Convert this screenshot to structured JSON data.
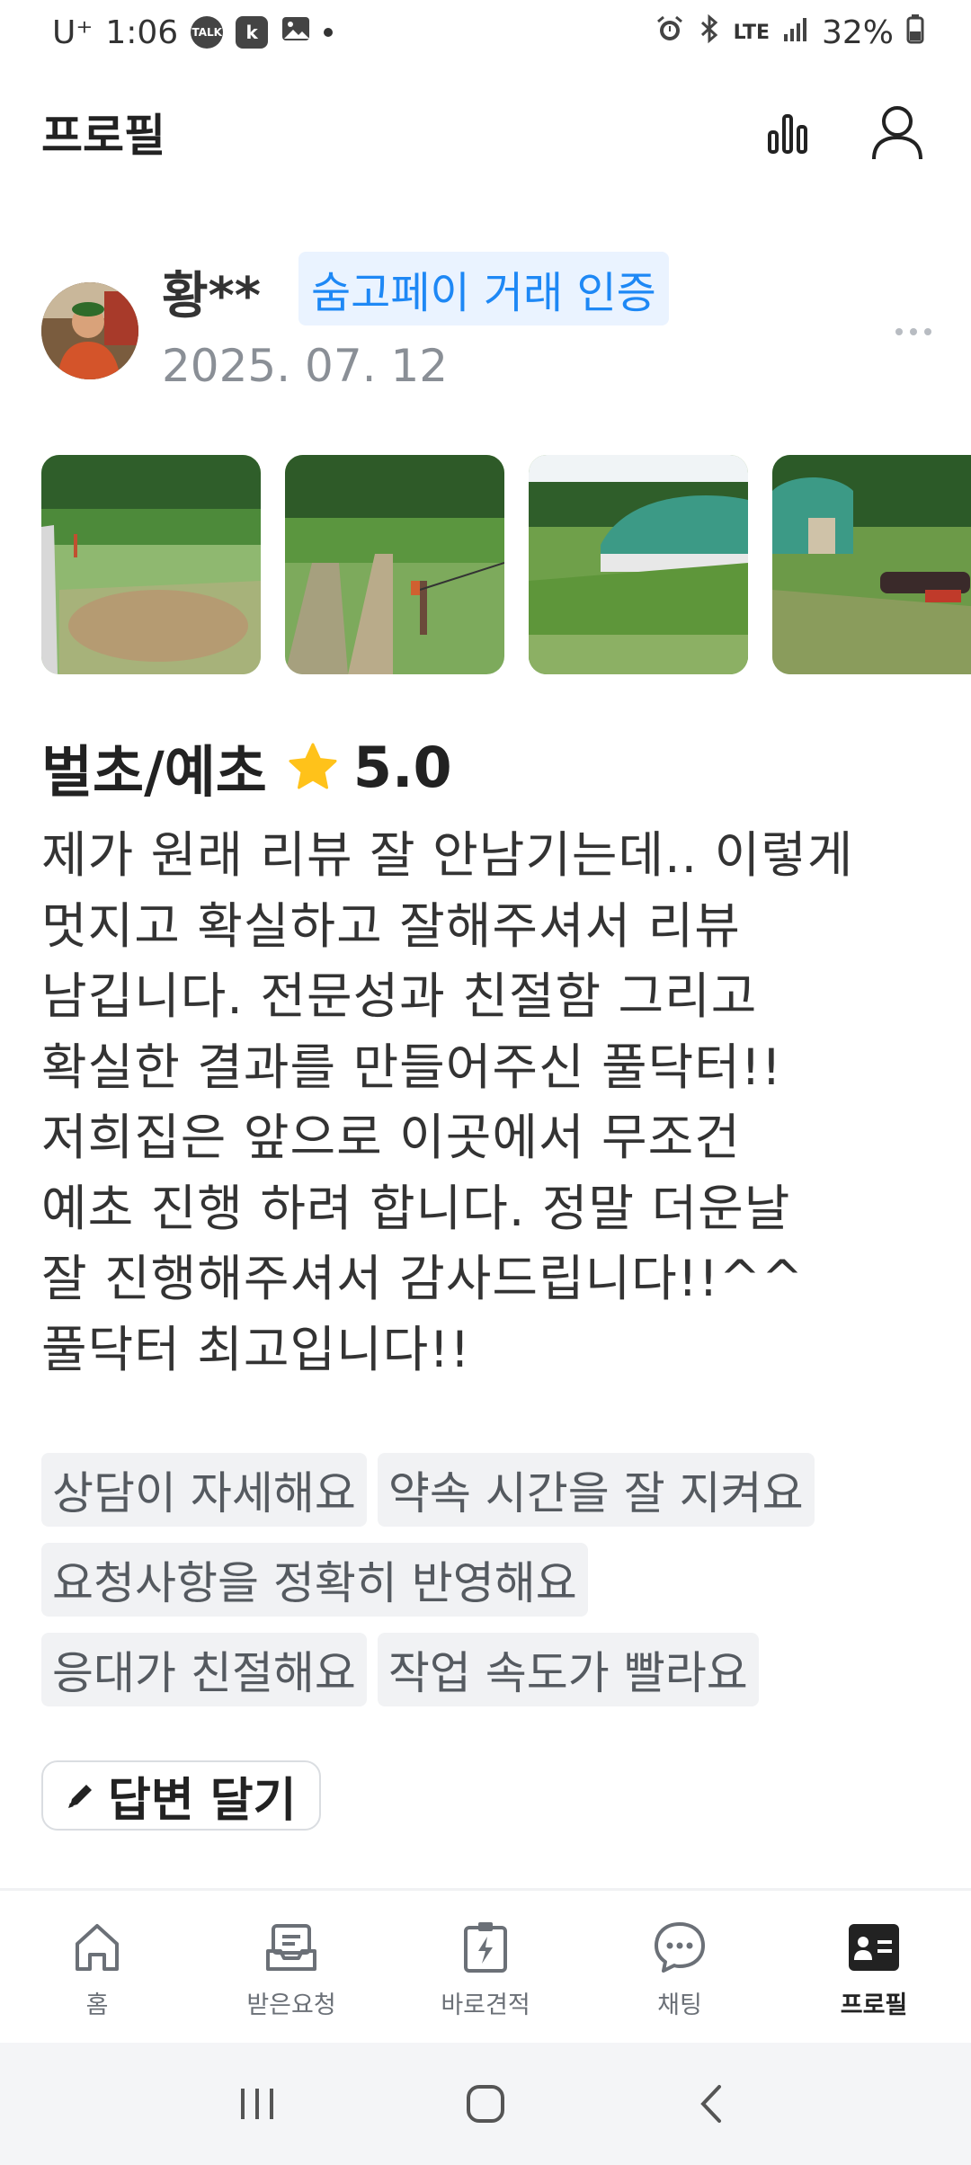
{
  "status_bar": {
    "carrier": "U⁺",
    "time": "1:06",
    "talk_badge": "TALK",
    "k_badge": "k",
    "network": "LTE",
    "battery": "32%"
  },
  "header": {
    "title": "프로필"
  },
  "review": {
    "reviewer_name": "황**",
    "pay_badge": "숨고페이 거래 인증",
    "date": "2025. 07. 12",
    "service": "벌초/예초",
    "rating": "5.0",
    "text_lines": [
      "제가 원래 리뷰 잘 안남기는데.. 이렇게",
      "멋지고 확실하고 잘해주셔서 리뷰",
      "남깁니다. 전문성과 친절함 그리고",
      "확실한 결과를 만들어주신 풀닥터!!",
      "저희집은 앞으로 이곳에서 무조건",
      "예초 진행 하려 합니다. 정말 더운날",
      "잘 진행해주셔서 감사드립니다!!^^",
      "풀닥터 최고입니다!!"
    ],
    "tags": [
      "상담이 자세해요",
      "약속 시간을 잘 지켜요",
      "요청사항을 정확히 반영해요",
      "응대가 친절해요",
      "작업 속도가 빨라요"
    ],
    "reply_label": "답변 달기"
  },
  "bottom_nav": {
    "items": [
      {
        "label": "홈",
        "icon": "home-icon"
      },
      {
        "label": "받은요청",
        "icon": "inbox-icon"
      },
      {
        "label": "바로견적",
        "icon": "quick-quote-icon"
      },
      {
        "label": "채팅",
        "icon": "chat-icon"
      },
      {
        "label": "프로필",
        "icon": "profile-card-icon"
      }
    ],
    "active_index": 4
  },
  "colors": {
    "accent_blue": "#1e88f5",
    "star": "#ffc21a",
    "tag_bg": "#f1f2f4"
  }
}
